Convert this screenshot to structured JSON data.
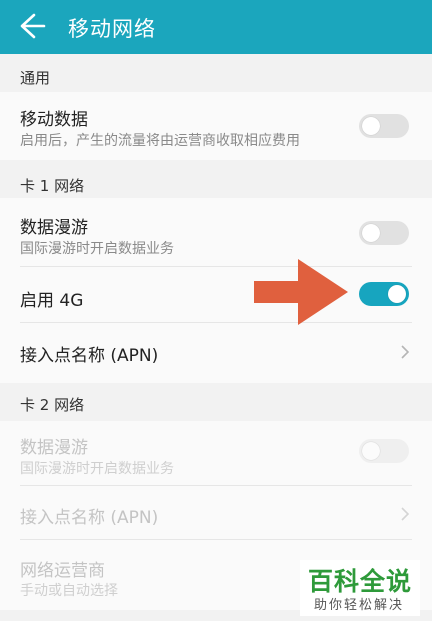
{
  "header": {
    "title": "移动网络",
    "back_icon": "arrow-left-icon"
  },
  "sections": {
    "general": "通用",
    "sim1": "卡 1 网络",
    "sim2": "卡 2 网络"
  },
  "general": {
    "mobile_data": {
      "title": "移动数据",
      "subtitle": "启用后，产生的流量将由运营商收取相应费用",
      "enabled": false
    }
  },
  "sim1": {
    "roaming": {
      "title": "数据漫游",
      "subtitle": "国际漫游时开启数据业务",
      "enabled": false
    },
    "lte": {
      "title": "启用 4G",
      "enabled": true
    },
    "apn": {
      "title": "接入点名称 (APN)"
    }
  },
  "sim2": {
    "roaming": {
      "title": "数据漫游",
      "subtitle": "国际漫游时开启数据业务",
      "enabled": false
    },
    "apn": {
      "title": "接入点名称 (APN)"
    },
    "operator": {
      "title": "网络运营商",
      "subtitle": "手动或自动选择"
    }
  },
  "watermark": {
    "title": "百科全说",
    "subtitle": "助你轻松解决"
  },
  "colors": {
    "accent": "#17a5bf",
    "appbar": "#1ba6bd",
    "annotation_arrow": "#e0603e",
    "watermark": "#2e9a3a"
  }
}
